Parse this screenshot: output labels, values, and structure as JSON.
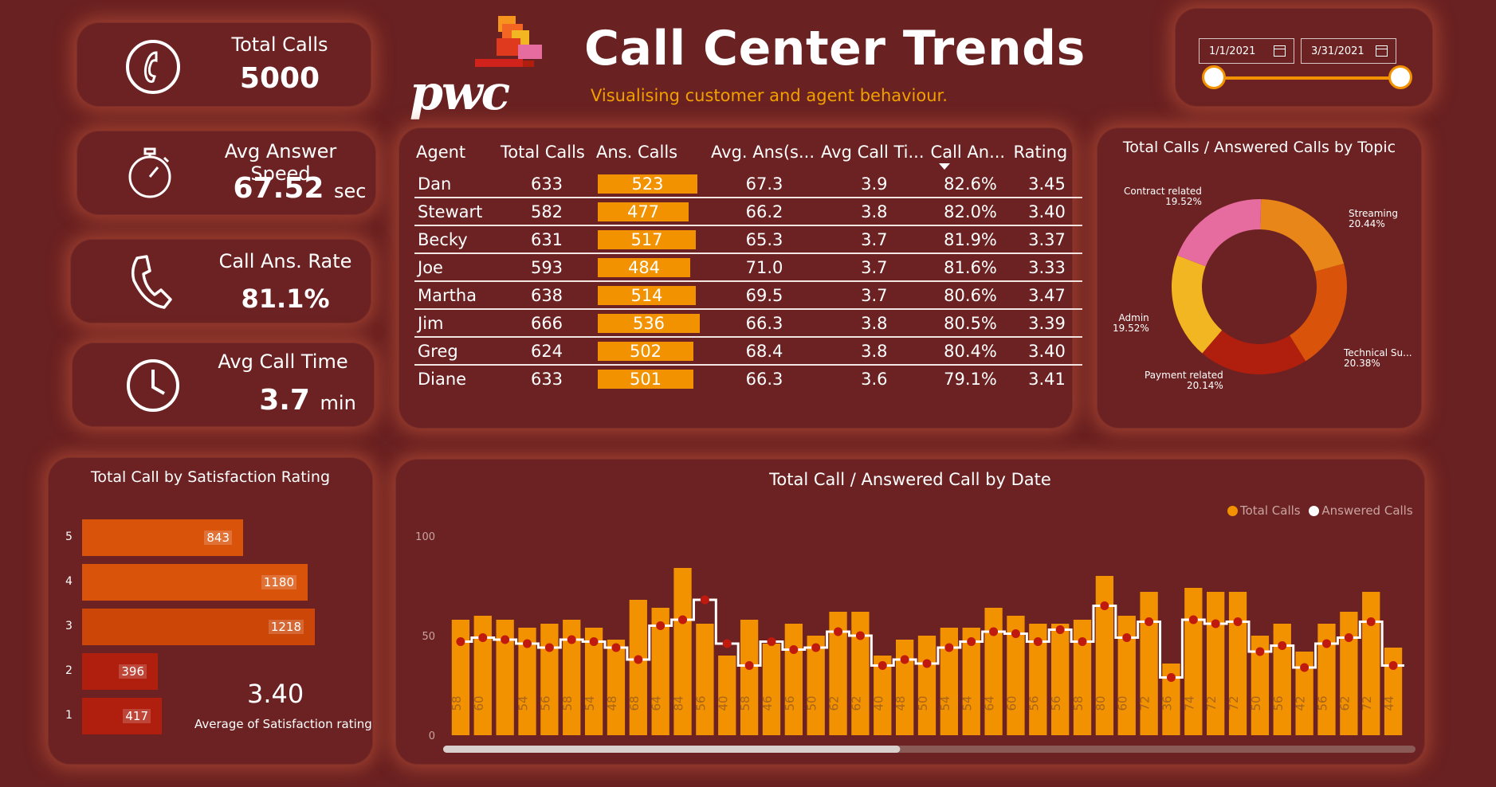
{
  "header": {
    "logo_text": "pwc",
    "title": "Call Center Trends",
    "subtitle": "Visualising customer and agent behaviour."
  },
  "date_filter": {
    "start": "1/1/2021",
    "end": "3/31/2021",
    "start_icon": "calendar-icon",
    "end_icon": "calendar-icon"
  },
  "kpis": {
    "total_calls": {
      "label": "Total Calls",
      "value": "5000",
      "icon": "phone-handset-circle-icon"
    },
    "avg_answer_speed": {
      "label": "Avg Answer Speed",
      "value": "67.52",
      "unit": "sec",
      "icon": "stopwatch-icon"
    },
    "call_ans_rate": {
      "label": "Call Ans. Rate",
      "value": "81.1%",
      "icon": "phone-handset-icon"
    },
    "avg_call_time": {
      "label": "Avg Call Time",
      "value": "3.7",
      "unit": "min",
      "icon": "clock-icon"
    }
  },
  "agent_table": {
    "columns": [
      "Agent",
      "Total Calls",
      "Ans. Calls",
      "Avg. Ans(s...",
      "Avg Call Ti...",
      "Call An...",
      "Rating"
    ],
    "sort_column": "Call An...",
    "ans_calls_max": 536,
    "rows": [
      {
        "agent": "Dan",
        "total": "633",
        "ans": "523",
        "avg_ans": "67.3",
        "avg_time": "3.9",
        "rate": "82.6%",
        "rating": "3.45"
      },
      {
        "agent": "Stewart",
        "total": "582",
        "ans": "477",
        "avg_ans": "66.2",
        "avg_time": "3.8",
        "rate": "82.0%",
        "rating": "3.40"
      },
      {
        "agent": "Becky",
        "total": "631",
        "ans": "517",
        "avg_ans": "65.3",
        "avg_time": "3.7",
        "rate": "81.9%",
        "rating": "3.37"
      },
      {
        "agent": "Joe",
        "total": "593",
        "ans": "484",
        "avg_ans": "71.0",
        "avg_time": "3.7",
        "rate": "81.6%",
        "rating": "3.33"
      },
      {
        "agent": "Martha",
        "total": "638",
        "ans": "514",
        "avg_ans": "69.5",
        "avg_time": "3.7",
        "rate": "80.6%",
        "rating": "3.47"
      },
      {
        "agent": "Jim",
        "total": "666",
        "ans": "536",
        "avg_ans": "66.3",
        "avg_time": "3.8",
        "rate": "80.5%",
        "rating": "3.39"
      },
      {
        "agent": "Greg",
        "total": "624",
        "ans": "502",
        "avg_ans": "68.4",
        "avg_time": "3.8",
        "rate": "80.4%",
        "rating": "3.40"
      },
      {
        "agent": "Diane",
        "total": "633",
        "ans": "501",
        "avg_ans": "66.3",
        "avg_time": "3.6",
        "rate": "79.1%",
        "rating": "3.41"
      }
    ]
  },
  "satisfaction": {
    "title": "Total Call by Satisfaction Rating",
    "average_value": "3.40",
    "average_label": "Average of Satisfaction rating"
  },
  "colors": {
    "accent": "#f39200",
    "background": "#6a2121",
    "bar_dark": "#b01e0e"
  },
  "chart_data": [
    {
      "type": "pie",
      "title": "Total Calls / Answered Calls by Topic",
      "donut": true,
      "slices": [
        {
          "label": "Streaming",
          "value": 20.44,
          "value_label": "20.44%",
          "color": "#e8861a"
        },
        {
          "label": "Technical Su...",
          "value": 20.38,
          "value_label": "20.38%",
          "color": "#d9530b"
        },
        {
          "label": "Payment related",
          "value": 20.14,
          "value_label": "20.14%",
          "color": "#b01e0e"
        },
        {
          "label": "Admin",
          "value": 19.52,
          "value_label": "19.52%",
          "color": "#f3b623"
        },
        {
          "label": "Contract related",
          "value": 19.52,
          "value_label": "19.52%",
          "color": "#e66b9e"
        }
      ]
    },
    {
      "type": "bar",
      "title": "Total Call by Satisfaction Rating",
      "orientation": "horizontal",
      "categories": [
        "5",
        "4",
        "3",
        "2",
        "1"
      ],
      "values": [
        843,
        1180,
        1218,
        396,
        417
      ],
      "colors": [
        "#d9530b",
        "#d9530b",
        "#cc4608",
        "#b01e0e",
        "#b01e0e"
      ],
      "xlim": [
        0,
        1250
      ]
    },
    {
      "type": "bar",
      "title": "Total Call / Answered Call by Date",
      "ylim": [
        0,
        100
      ],
      "yticks": [
        "0",
        "50",
        "100"
      ],
      "legend": "top-right",
      "series": [
        {
          "name": "Total Calls",
          "color": "#f39200",
          "values": [
            58,
            60,
            58,
            54,
            56,
            58,
            54,
            48,
            68,
            64,
            84,
            56,
            40,
            58,
            46,
            56,
            50,
            62,
            62,
            40,
            48,
            50,
            54,
            54,
            64,
            60,
            56,
            56,
            58,
            80,
            60,
            72,
            36,
            74,
            72,
            72,
            50,
            56,
            42,
            56,
            62,
            72,
            44
          ]
        },
        {
          "name": "Answered Calls",
          "color": "#ffffff",
          "values": [
            47,
            49,
            48,
            46,
            44,
            48,
            47,
            44,
            38,
            55,
            58,
            68,
            46,
            35,
            47,
            43,
            44,
            52,
            50,
            35,
            38,
            36,
            44,
            47,
            52,
            51,
            47,
            53,
            47,
            65,
            49,
            57,
            29,
            58,
            56,
            57,
            42,
            45,
            34,
            46,
            49,
            57,
            35
          ]
        }
      ],
      "bar_labels": [
        "58",
        "60",
        "",
        "54",
        "56",
        "58",
        "54",
        "48",
        "68",
        "64",
        "84",
        "56",
        "40",
        "58",
        "46",
        "56",
        "50",
        "62",
        "62",
        "40",
        "48",
        "50",
        "54",
        "54",
        "64",
        "60",
        "56",
        "56",
        "58",
        "80",
        "60",
        "72",
        "36",
        "74",
        "72",
        "72",
        "50",
        "56",
        "42",
        "56",
        "62",
        "72",
        "44"
      ],
      "scroll_position": 0.47
    }
  ]
}
